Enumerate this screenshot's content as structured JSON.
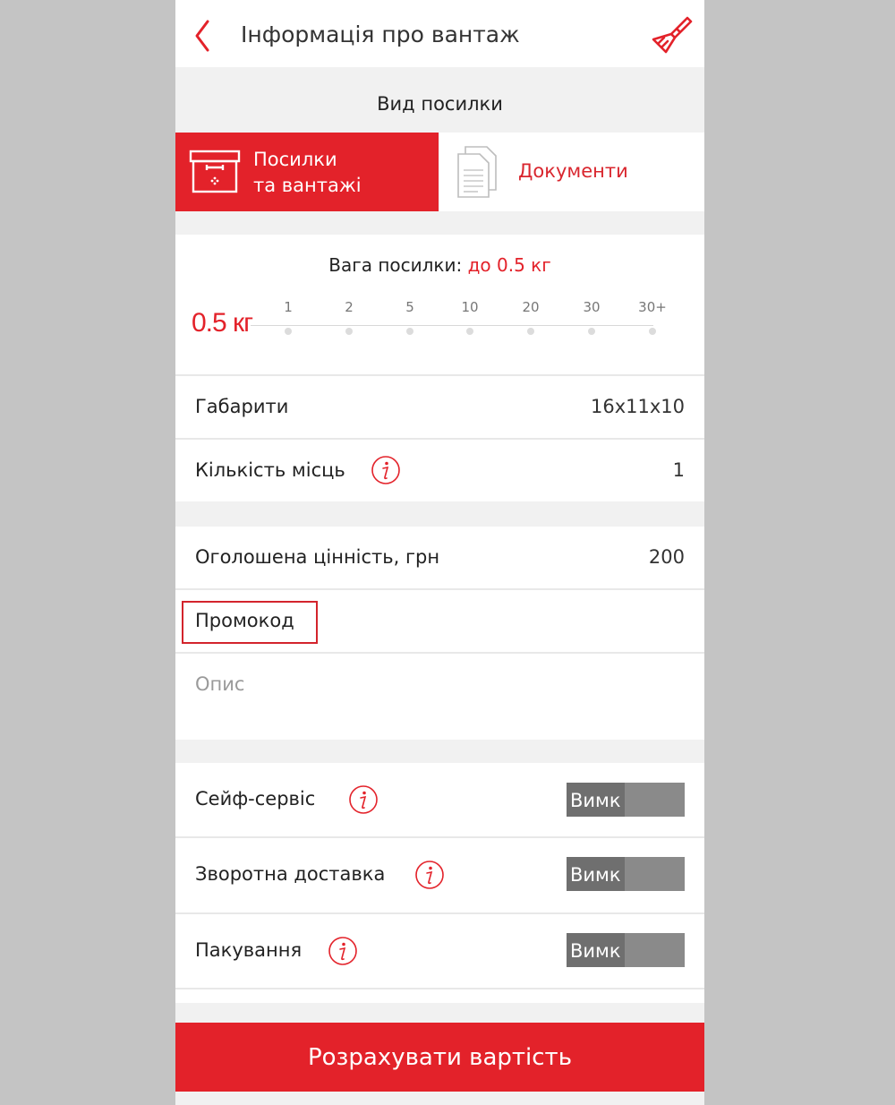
{
  "header": {
    "title": "Інформація про вантаж",
    "back_icon": "chevron-left-icon",
    "clear_icon": "brush-icon",
    "accent_color": "#e3222a"
  },
  "parcel_type": {
    "title": "Вид посилки",
    "tabs": [
      {
        "label_line1": "Посилки",
        "label_line2": "та вантажі",
        "icon": "box-icon",
        "selected": true
      },
      {
        "label": "Документи",
        "icon": "document-icon",
        "selected": false
      }
    ]
  },
  "weight": {
    "title_prefix": "Вага посилки: ",
    "title_value": "до 0.5 кг",
    "current": "0.5 кг",
    "options": [
      "1",
      "2",
      "5",
      "10",
      "20",
      "30",
      "30+"
    ]
  },
  "dimensions": {
    "label": "Габарити",
    "value": "16x11x10"
  },
  "places": {
    "label": "Кількість місць",
    "value": "1",
    "info_icon": "info-icon"
  },
  "declared_value": {
    "label": "Оголошена цінність, грн",
    "value": "200"
  },
  "promo": {
    "label": "Промокод"
  },
  "description": {
    "placeholder": "Опис"
  },
  "services": [
    {
      "label": "Сейф-сервіс",
      "toggle": "Вимк"
    },
    {
      "label": "Зворотна доставка",
      "toggle": "Вимк"
    },
    {
      "label": "Пакування",
      "toggle": "Вимк"
    }
  ],
  "calculate_button": "Розрахувати вартість"
}
